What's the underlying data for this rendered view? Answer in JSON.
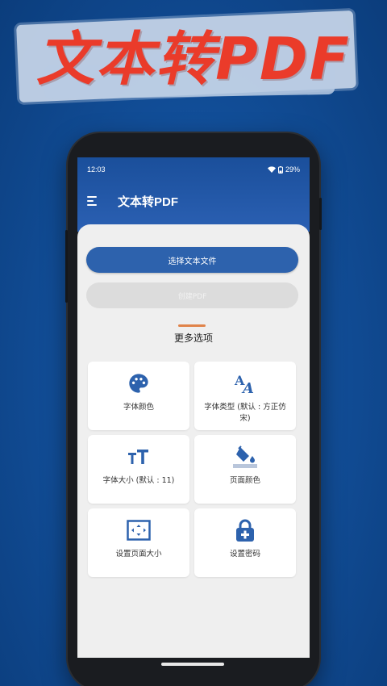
{
  "banner": {
    "title": "文本转PDF"
  },
  "status_bar": {
    "time": "12:03",
    "battery": "29%"
  },
  "app_bar": {
    "title": "文本转PDF"
  },
  "actions": {
    "select_file_label": "选择文本文件",
    "create_pdf_label": "创建PDF"
  },
  "more_options": {
    "title": "更多选项",
    "items": [
      {
        "label": "字体颜色",
        "icon": "palette-icon"
      },
      {
        "label": "字体类型 (默认 : 方正仿宋)",
        "icon": "font-type-icon"
      },
      {
        "label": "字体大小 (默认 : 11)",
        "icon": "font-size-icon"
      },
      {
        "label": "页面颜色",
        "icon": "paint-bucket-icon"
      },
      {
        "label": "设置页面大小",
        "icon": "page-size-icon"
      },
      {
        "label": "设置密码",
        "icon": "lock-plus-icon"
      }
    ]
  },
  "colors": {
    "accent_blue": "#2d62ad",
    "banner_red": "#ea3b2a",
    "divider_orange": "#e0834a"
  }
}
